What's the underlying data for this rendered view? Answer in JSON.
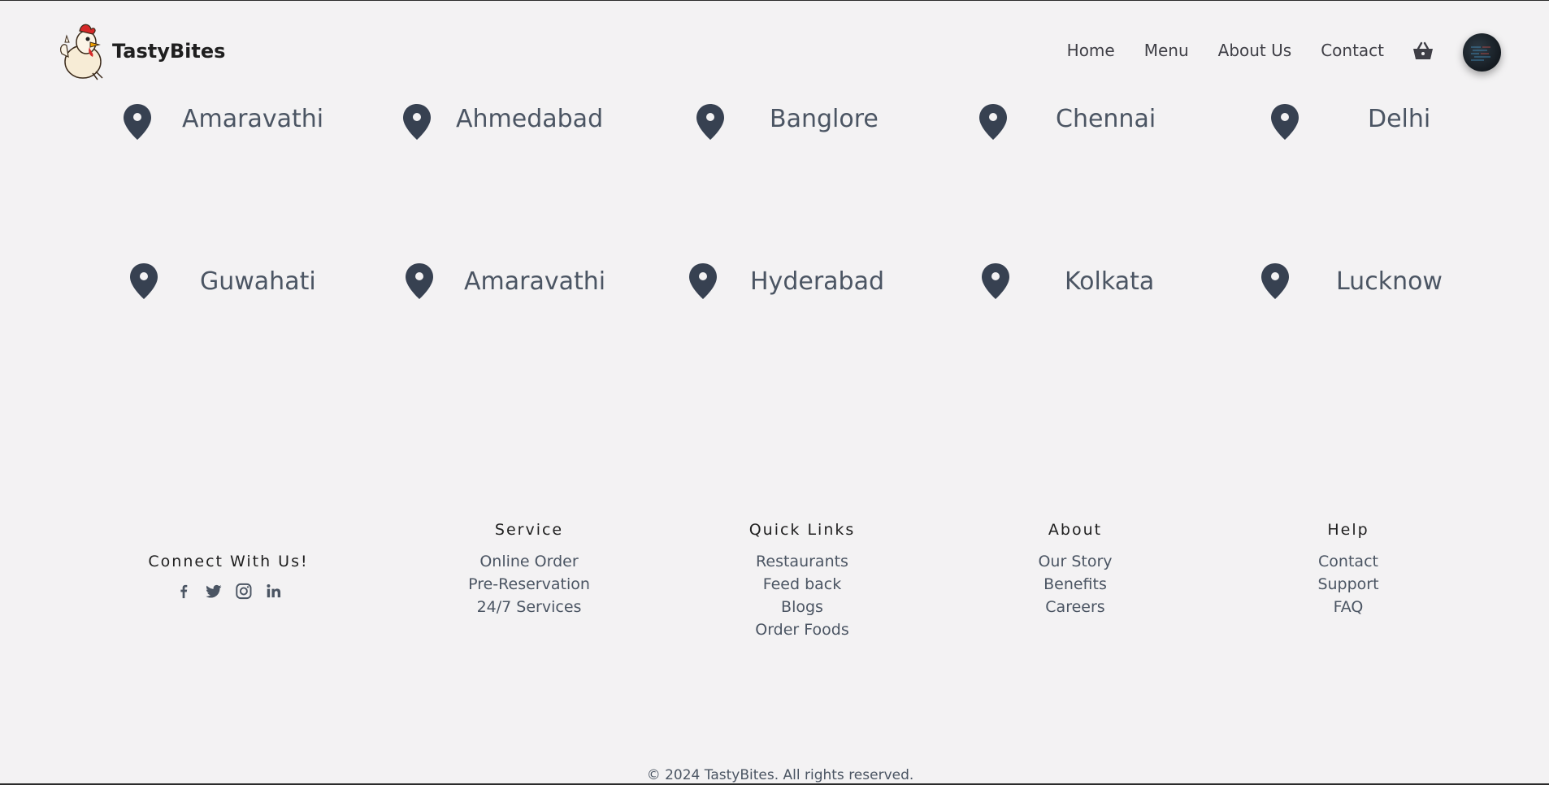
{
  "brand": {
    "name": "TastyBites"
  },
  "nav": {
    "links": [
      "Home",
      "Menu",
      "About Us",
      "Contact"
    ]
  },
  "locations": {
    "row1": [
      "Amaravathi",
      "Ahmedabad",
      "Banglore",
      "Chennai",
      "Delhi"
    ],
    "row2": [
      "Guwahati",
      "Amaravathi",
      "Hyderabad",
      "Kolkata",
      "Lucknow"
    ]
  },
  "footer": {
    "connect": {
      "heading": "Connect With Us!",
      "icons": [
        "facebook-icon",
        "twitter-icon",
        "instagram-icon",
        "linkedin-icon"
      ]
    },
    "columns": [
      {
        "heading": "Service",
        "links": [
          "Online Order",
          "Pre-Reservation",
          "24/7 Services"
        ]
      },
      {
        "heading": "Quick Links",
        "links": [
          "Restaurants",
          "Feed back",
          "Blogs",
          "Order Foods"
        ]
      },
      {
        "heading": "About",
        "links": [
          "Our Story",
          "Benefits",
          "Careers"
        ]
      },
      {
        "heading": "Help",
        "links": [
          "Contact",
          "Support",
          "FAQ"
        ]
      }
    ],
    "copyright": "© 2024 TastyBites. All rights reserved."
  },
  "colors": {
    "background": "#f3f2f3",
    "pin": "#374151",
    "text": "#4b5563",
    "heading": "#1f1f1f"
  }
}
